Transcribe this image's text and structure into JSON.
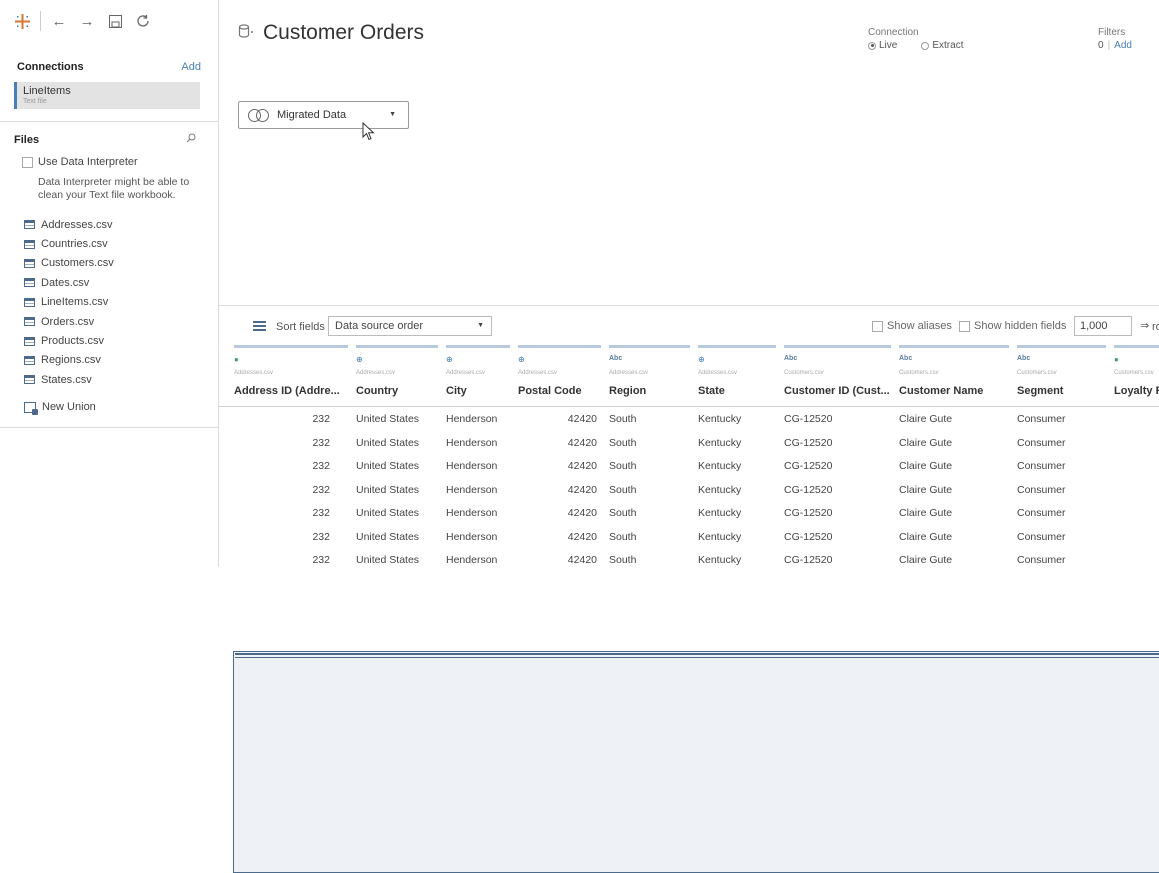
{
  "toolbar": {
    "icons": [
      "tableau-logo-icon",
      "back-arrow-icon",
      "forward-arrow-icon",
      "save-icon",
      "refresh-icon"
    ]
  },
  "connections": {
    "title": "Connections",
    "add_label": "Add",
    "item": {
      "name": "LineItems",
      "type": "Text file"
    }
  },
  "files": {
    "title": "Files",
    "interpreter_label": "Use Data Interpreter",
    "interpreter_note": "Data Interpreter might be able to clean your Text file workbook.",
    "items": [
      "Addresses.csv",
      "Countries.csv",
      "Customers.csv",
      "Dates.csv",
      "LineItems.csv",
      "Orders.csv",
      "Products.csv",
      "Regions.csv",
      "States.csv"
    ],
    "new_union": "New Union"
  },
  "datasource": {
    "name": "Customer Orders"
  },
  "connection": {
    "label": "Connection",
    "live": "Live",
    "extract": "Extract",
    "selected": "Live"
  },
  "filters": {
    "label": "Filters",
    "count": "0",
    "add": "Add"
  },
  "canvas": {
    "table_label": "Migrated Data"
  },
  "grid_toolbar": {
    "sort_label": "Sort fields",
    "sort_value": "Data source order",
    "show_aliases": "Show aliases",
    "show_hidden": "Show hidden fields",
    "rows_value": "1,000",
    "rows_label": "ro"
  },
  "columns": [
    {
      "type": "#",
      "source": "Addresses.csv",
      "name": "Address ID (Addre..."
    },
    {
      "type": "⊕",
      "source": "Addresses.csv",
      "name": "Country"
    },
    {
      "type": "⊕",
      "source": "Addresses.csv",
      "name": "City"
    },
    {
      "type": "⊕",
      "source": "Addresses.csv",
      "name": "Postal Code"
    },
    {
      "type": "Abc",
      "source": "Addresses.csv",
      "name": "Region"
    },
    {
      "type": "⊕",
      "source": "Addresses.csv",
      "name": "State"
    },
    {
      "type": "Abc",
      "source": "Customers.csv",
      "name": "Customer ID (Cust..."
    },
    {
      "type": "Abc",
      "source": "Customers.csv",
      "name": "Customer Name"
    },
    {
      "type": "Abc",
      "source": "Customers.csv",
      "name": "Segment"
    },
    {
      "type": "#",
      "source": "Customers.csv",
      "name": "Loyalty R"
    }
  ],
  "rows": [
    [
      "232",
      "United States",
      "Henderson",
      "42420",
      "South",
      "Kentucky",
      "CG-12520",
      "Claire Gute",
      "Consumer",
      ""
    ],
    [
      "232",
      "United States",
      "Henderson",
      "42420",
      "South",
      "Kentucky",
      "CG-12520",
      "Claire Gute",
      "Consumer",
      ""
    ],
    [
      "232",
      "United States",
      "Henderson",
      "42420",
      "South",
      "Kentucky",
      "CG-12520",
      "Claire Gute",
      "Consumer",
      ""
    ],
    [
      "232",
      "United States",
      "Henderson",
      "42420",
      "South",
      "Kentucky",
      "CG-12520",
      "Claire Gute",
      "Consumer",
      ""
    ],
    [
      "232",
      "United States",
      "Henderson",
      "42420",
      "South",
      "Kentucky",
      "CG-12520",
      "Claire Gute",
      "Consumer",
      ""
    ],
    [
      "232",
      "United States",
      "Henderson",
      "42420",
      "South",
      "Kentucky",
      "CG-12520",
      "Claire Gute",
      "Consumer",
      ""
    ],
    [
      "232",
      "United States",
      "Henderson",
      "42420",
      "South",
      "Kentucky",
      "CG-12520",
      "Claire Gute",
      "Consumer",
      ""
    ]
  ],
  "colors": {
    "accent": "#4a7eb5",
    "header_bar": "#b8c9db",
    "selected_bg": "#e3e3e3"
  }
}
